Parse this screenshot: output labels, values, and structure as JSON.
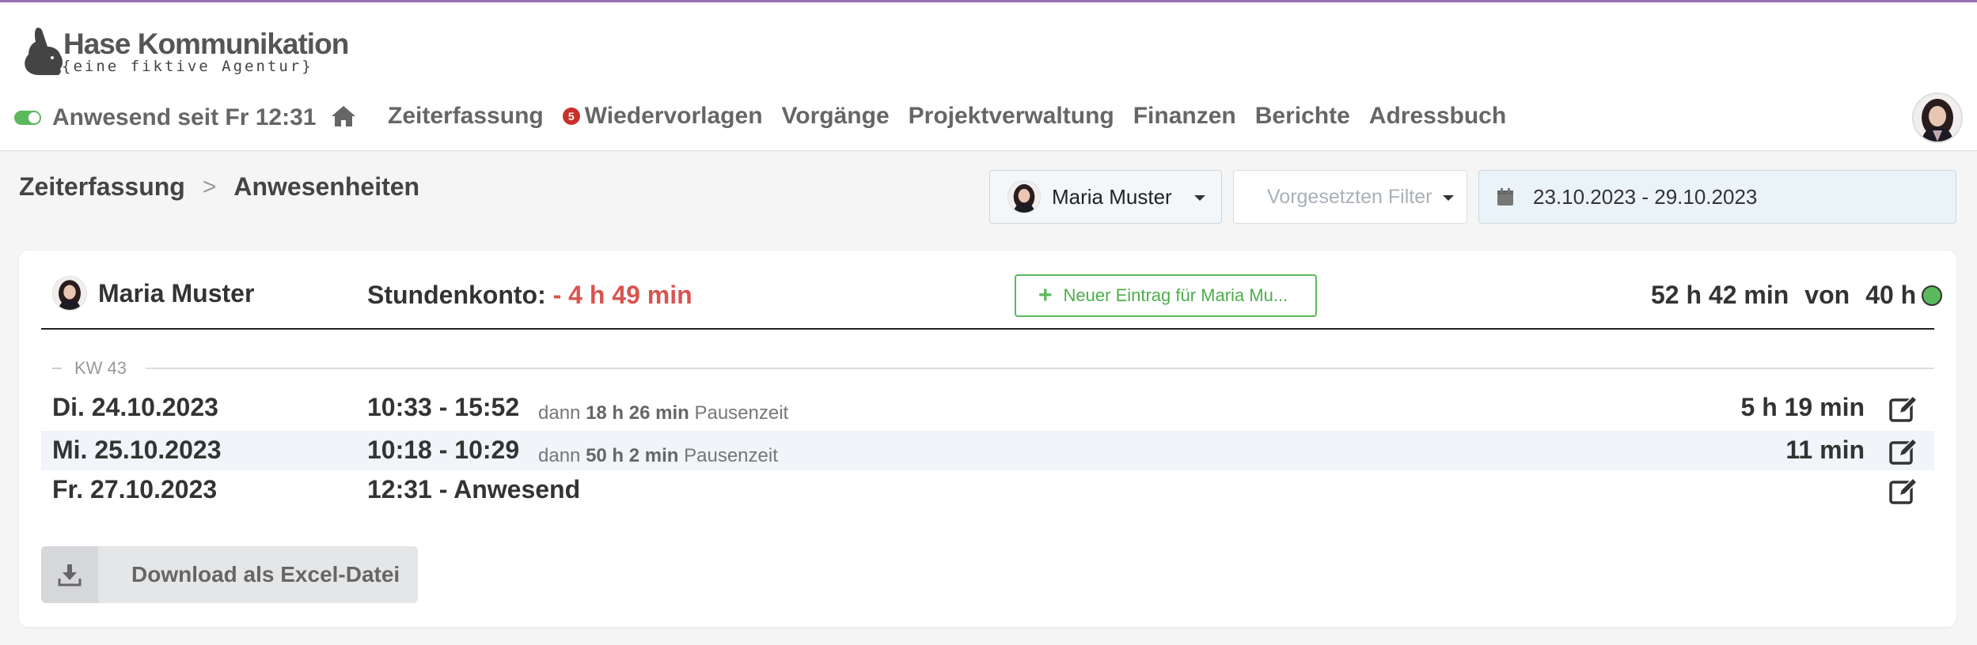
{
  "brand": {
    "name": "Hase  Kommunikation",
    "tagline": "{eine fiktive Agentur}"
  },
  "presence": {
    "text": "Anwesend seit Fr 12:31",
    "toggle_on": true
  },
  "nav": {
    "home_icon": "home-icon",
    "items": [
      {
        "label": "Zeiterfassung"
      },
      {
        "label": "Wiedervorlagen",
        "badge": "5"
      },
      {
        "label": "Vorgänge"
      },
      {
        "label": "Projektverwaltung"
      },
      {
        "label": "Finanzen"
      },
      {
        "label": "Berichte"
      },
      {
        "label": "Adressbuch"
      }
    ]
  },
  "breadcrumb": {
    "parent": "Zeiterfassung",
    "separator": ">",
    "current": "Anwesenheiten"
  },
  "filters": {
    "user": "Maria Muster",
    "supervisor_placeholder": "Vorgesetzten Filter",
    "date_range": "23.10.2023 - 29.10.2023"
  },
  "summary": {
    "name": "Maria Muster",
    "konto_label": "Stundenkonto:",
    "konto_value": "- 4 h 49 min",
    "new_entry_label": "Neuer Eintrag für Maria Mu...",
    "total": "52 h 42 min",
    "von": "von",
    "target": "40 h",
    "status_color": "#5cb85c"
  },
  "week": {
    "label": "KW 43"
  },
  "entries": [
    {
      "date": "Di. 24.10.2023",
      "time": "10:33 - 15:52",
      "pause_prefix": "dann",
      "pause_value": "18 h 26 min",
      "pause_suffix": "Pausenzeit",
      "duration": "5 h 19 min"
    },
    {
      "date": "Mi. 25.10.2023",
      "time": "10:18 - 10:29",
      "pause_prefix": "dann",
      "pause_value": "50 h 2 min",
      "pause_suffix": "Pausenzeit",
      "duration": "11 min"
    },
    {
      "date": "Fr. 27.10.2023",
      "time": "12:31 - Anwesend",
      "duration": ""
    }
  ],
  "download": {
    "label": "Download als Excel-Datei"
  },
  "colors": {
    "accent_top": "#9b6fb3",
    "negative": "#d9534f",
    "success": "#5cb85c",
    "badge": "#c9302c"
  }
}
